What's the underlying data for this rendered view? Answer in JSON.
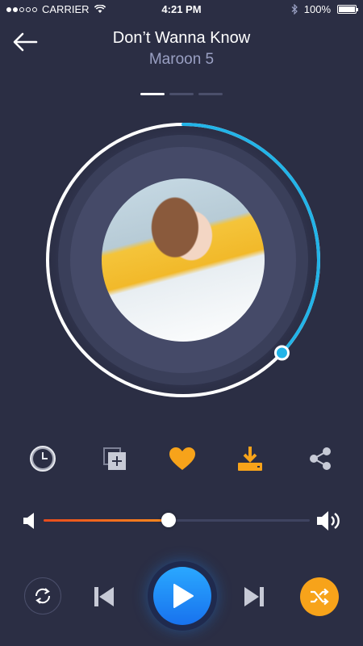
{
  "status_bar": {
    "carrier": "CARRIER",
    "time": "4:21 PM",
    "battery": "100%"
  },
  "header": {
    "title": "Don’t Wanna Know",
    "artist": "Maroon 5",
    "back_icon": "arrow-left-icon"
  },
  "pager": {
    "pages": 3,
    "active": 0
  },
  "player": {
    "playback_progress": 0.37,
    "volume_level": 0.47
  },
  "actions": [
    {
      "icon": "clock-icon"
    },
    {
      "icon": "add-to-playlist-icon"
    },
    {
      "icon": "heart-icon",
      "color": "#f7a31a"
    },
    {
      "icon": "download-icon",
      "color": "#f7a31a"
    },
    {
      "icon": "share-icon"
    }
  ],
  "controls": {
    "repeat_icon": "repeat-icon",
    "previous_icon": "skip-previous-icon",
    "play_icon": "play-icon",
    "next_icon": "skip-next-icon",
    "shuffle_icon": "shuffle-icon"
  },
  "colors": {
    "background": "#2b2e44",
    "accent": "#f7a31a",
    "progress": "#22b4e8",
    "play_button": "#1e88f5"
  }
}
